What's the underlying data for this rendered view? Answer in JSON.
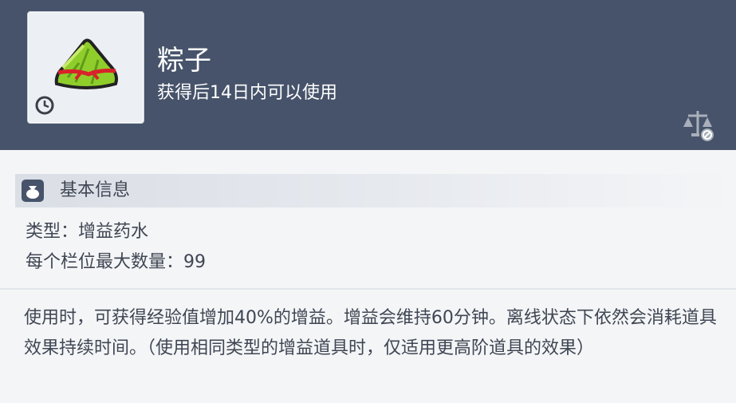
{
  "item": {
    "name": "粽子",
    "expiry": "获得后14日内可以使用",
    "icon": "zongzi-icon"
  },
  "basic_info": {
    "section_label": "基本信息",
    "type_line": "类型：增益药水",
    "max_stack_line": "每个栏位最大数量：99"
  },
  "description": "使用时，可获得经验值增加40%的增益。增益会维持60分钟。离线状态下依然会消耗道具效果持续时间。（使用相同类型的增益道具时，仅适用更高阶道具的效果）",
  "colors": {
    "header_bg": "#46536a",
    "body_bg": "#f4f5f7",
    "text": "#3f4653"
  }
}
